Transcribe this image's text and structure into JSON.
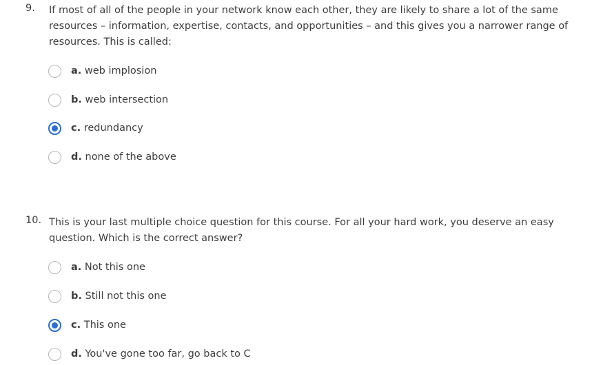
{
  "questions": [
    {
      "number": "9.",
      "text": "If most of all of the people in your network know each other, they are likely to share a lot of the same resources – information, expertise, contacts, and opportunities – and this gives you a narrower range of resources. This is called:",
      "options": [
        {
          "letter": "a.",
          "text": "web implosion",
          "selected": false
        },
        {
          "letter": "b.",
          "text": "web intersection",
          "selected": false
        },
        {
          "letter": "c.",
          "text": "redundancy",
          "selected": true
        },
        {
          "letter": "d.",
          "text": "none of the above",
          "selected": false
        }
      ]
    },
    {
      "number": "10.",
      "text": "This is your last multiple choice question for this course. For all your hard work, you deserve an easy question. Which is the correct answer?",
      "options": [
        {
          "letter": "a.",
          "text": "Not this one",
          "selected": false
        },
        {
          "letter": "b.",
          "text": "Still not this one",
          "selected": false
        },
        {
          "letter": "c.",
          "text": "This one",
          "selected": true
        },
        {
          "letter": "d.",
          "text": "You've gone too far, go back to C",
          "selected": false
        }
      ]
    }
  ],
  "colors": {
    "selected_radio": "#2a6fd1",
    "radio_border": "#b5b5b5",
    "text": "#3d3d3d"
  }
}
